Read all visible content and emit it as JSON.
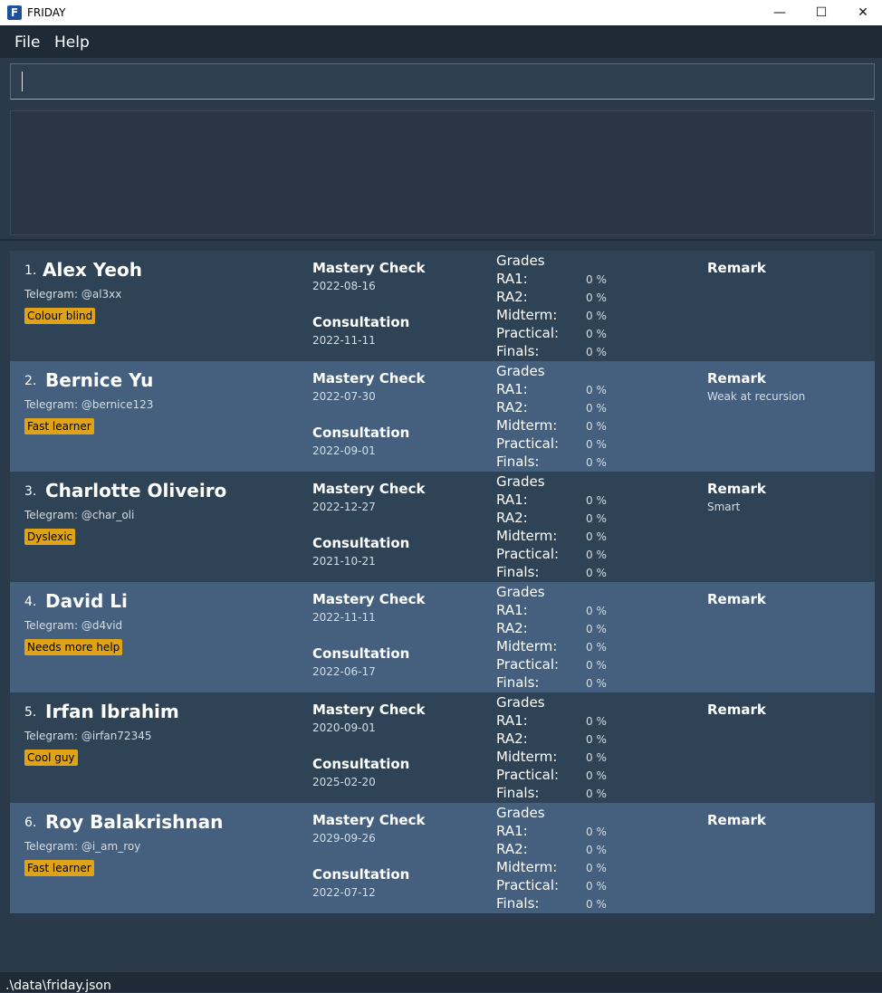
{
  "window": {
    "title": "FRIDAY",
    "icon_letter": "F",
    "controls": {
      "minimize": "—",
      "maximize": "☐",
      "close": "✕"
    }
  },
  "menu": {
    "file": "File",
    "help": "Help"
  },
  "command_input": {
    "value": ""
  },
  "result_display": {
    "text": ""
  },
  "labels": {
    "mastery": "Mastery Check",
    "consultation": "Consultation",
    "grades": "Grades",
    "remark": "Remark",
    "telegram_prefix": "Telegram: ",
    "grade_names": [
      "RA1:",
      "RA2:",
      "Midterm:",
      "Practical:",
      "Finals:"
    ]
  },
  "students": [
    {
      "index": "1.",
      "name": "Alex Yeoh",
      "telegram": "Telegram: @al3xx",
      "tag": "Colour blind",
      "mastery_date": "2022-08-16",
      "consultation_date": "2022-11-11",
      "grades": [
        "0 %",
        "0 %",
        "0 %",
        "0 %",
        "0 %"
      ],
      "remark": ""
    },
    {
      "index": "2.",
      "name": "Bernice Yu",
      "telegram": "Telegram: @bernice123",
      "tag": "Fast learner",
      "mastery_date": "2022-07-30",
      "consultation_date": "2022-09-01",
      "grades": [
        "0 %",
        "0 %",
        "0 %",
        "0 %",
        "0 %"
      ],
      "remark": "Weak at recursion"
    },
    {
      "index": "3.",
      "name": "Charlotte Oliveiro",
      "telegram": "Telegram: @char_oli",
      "tag": "Dyslexic",
      "mastery_date": "2022-12-27",
      "consultation_date": "2021-10-21",
      "grades": [
        "0 %",
        "0 %",
        "0 %",
        "0 %",
        "0 %"
      ],
      "remark": "Smart"
    },
    {
      "index": "4.",
      "name": "David Li",
      "telegram": "Telegram: @d4vid",
      "tag": "Needs more help",
      "mastery_date": "2022-11-11",
      "consultation_date": "2022-06-17",
      "grades": [
        "0 %",
        "0 %",
        "0 %",
        "0 %",
        "0 %"
      ],
      "remark": ""
    },
    {
      "index": "5.",
      "name": "Irfan Ibrahim",
      "telegram": "Telegram: @irfan72345",
      "tag": "Cool guy",
      "mastery_date": "2020-09-01",
      "consultation_date": "2025-02-20",
      "grades": [
        "0 %",
        "0 %",
        "0 %",
        "0 %",
        "0 %"
      ],
      "remark": ""
    },
    {
      "index": "6.",
      "name": "Roy Balakrishnan",
      "telegram": "Telegram: @i_am_roy",
      "tag": "Fast learner",
      "mastery_date": "2029-09-26",
      "consultation_date": "2022-07-12",
      "grades": [
        "0 %",
        "0 %",
        "0 %",
        "0 %",
        "0 %"
      ],
      "remark": ""
    }
  ],
  "status_bar": {
    "path": ".\\data\\friday.json"
  },
  "colors": {
    "tag_bg": "#e0a316",
    "card_dark": "#2e4356",
    "card_light": "#44607e",
    "background": "#2b3a4a"
  }
}
